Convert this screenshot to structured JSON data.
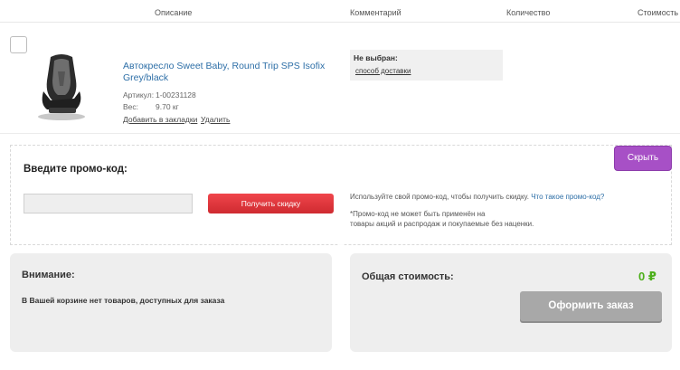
{
  "header": {
    "col_description": "Описание",
    "col_comment": "Комментарий",
    "col_quantity": "Количество",
    "col_cost": "Стоимость"
  },
  "product": {
    "title": "Автокресло Sweet Baby, Round Trip SPS Isofix Grey/black",
    "sku_label": "Артикул:",
    "sku_value": "1-00231128",
    "weight_label": "Вес:",
    "weight_value": "9.70 кг",
    "bookmark_link": "Добавить в закладки",
    "delete_link": "Удалить",
    "delivery_label": "Не выбран:",
    "delivery_link": "способ доставки"
  },
  "promo": {
    "title": "Введите промо-код:",
    "input_value": "",
    "apply_button": "Получить скидку",
    "hide_button": "Скрыть",
    "info_text": "Используйте свой промо-код, чтобы получить скидку.",
    "info_link": "Что такое промо-код?",
    "note_line1": "*Промо-код не может быть применён на",
    "note_line2": "товары акций и распродаж и покупаемые без наценки."
  },
  "warning": {
    "title": "Внимание:",
    "text": "В Вашей корзине нет товаров, доступных для заказа"
  },
  "total": {
    "title": "Общая стоимость:",
    "value": "0 ₽",
    "order_button": "Оформить заказ"
  },
  "colors": {
    "link": "#2e6fa7",
    "promo_button": "#e0383e",
    "hide_button": "#a750c6",
    "total_value": "#4caf1a",
    "order_button": "#a8a8a8"
  }
}
